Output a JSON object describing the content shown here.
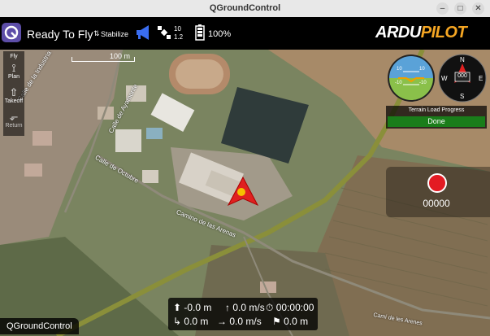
{
  "window": {
    "title": "QGroundControl",
    "controls": [
      "–",
      "□",
      "✕"
    ]
  },
  "toolbar": {
    "app_icon": "qgc-logo-icon",
    "status": "Ready To Fly",
    "mode_icon": "stabilize-icon",
    "flight_mode": "Stabilize",
    "messages_icon": "megaphone-icon",
    "gps_icon": "satellite-icon",
    "gps_sat_count": "10",
    "gps_hdop": "1.2",
    "battery_icon": "battery-icon",
    "battery": "100%",
    "brand": "ARDUPILOT",
    "brand_accent": "ARDU",
    "brand_rest": "PILOT"
  },
  "tools": [
    {
      "label": "Fly",
      "icon": "fly-icon"
    },
    {
      "label": "Plan",
      "icon": "plan-waypoint-icon"
    },
    {
      "label": "Takeoff",
      "icon": "takeoff-arrow-icon"
    },
    {
      "label": "Return",
      "icon": "return-arrow-icon"
    }
  ],
  "map": {
    "scale": "100 m",
    "road_labels": [
      "Calle de la Industria",
      "Calle de Ayamonte",
      "Calle de Octubre",
      "Camino de las Arenas",
      "Camí de les Arenes"
    ],
    "colors": {
      "road": "#8a8f3a",
      "roof": "#e8e6e0",
      "track": "#b48a6a",
      "pool": "#2f3b3a"
    }
  },
  "instruments": {
    "attitude": {
      "pitch_marks": [
        "10",
        "10",
        "-10",
        "-10"
      ]
    },
    "compass": {
      "heading": "000",
      "cardinals": [
        "N",
        "E",
        "S",
        "W"
      ]
    }
  },
  "terrain": {
    "title": "Terrain Load Progress",
    "status": "Done",
    "status_color": "#1a7d1a"
  },
  "recorder": {
    "time": "00000",
    "button_color": "#e31b23"
  },
  "stats": {
    "altitude": "-0.0 m",
    "vertical_speed": "0.0 m/s",
    "flight_time": "00:00:00",
    "distance": "0.0 m",
    "horizontal_speed": "0.0 m/s",
    "distance_to_home": "0.0 m"
  },
  "footer_label": "QGroundControl"
}
